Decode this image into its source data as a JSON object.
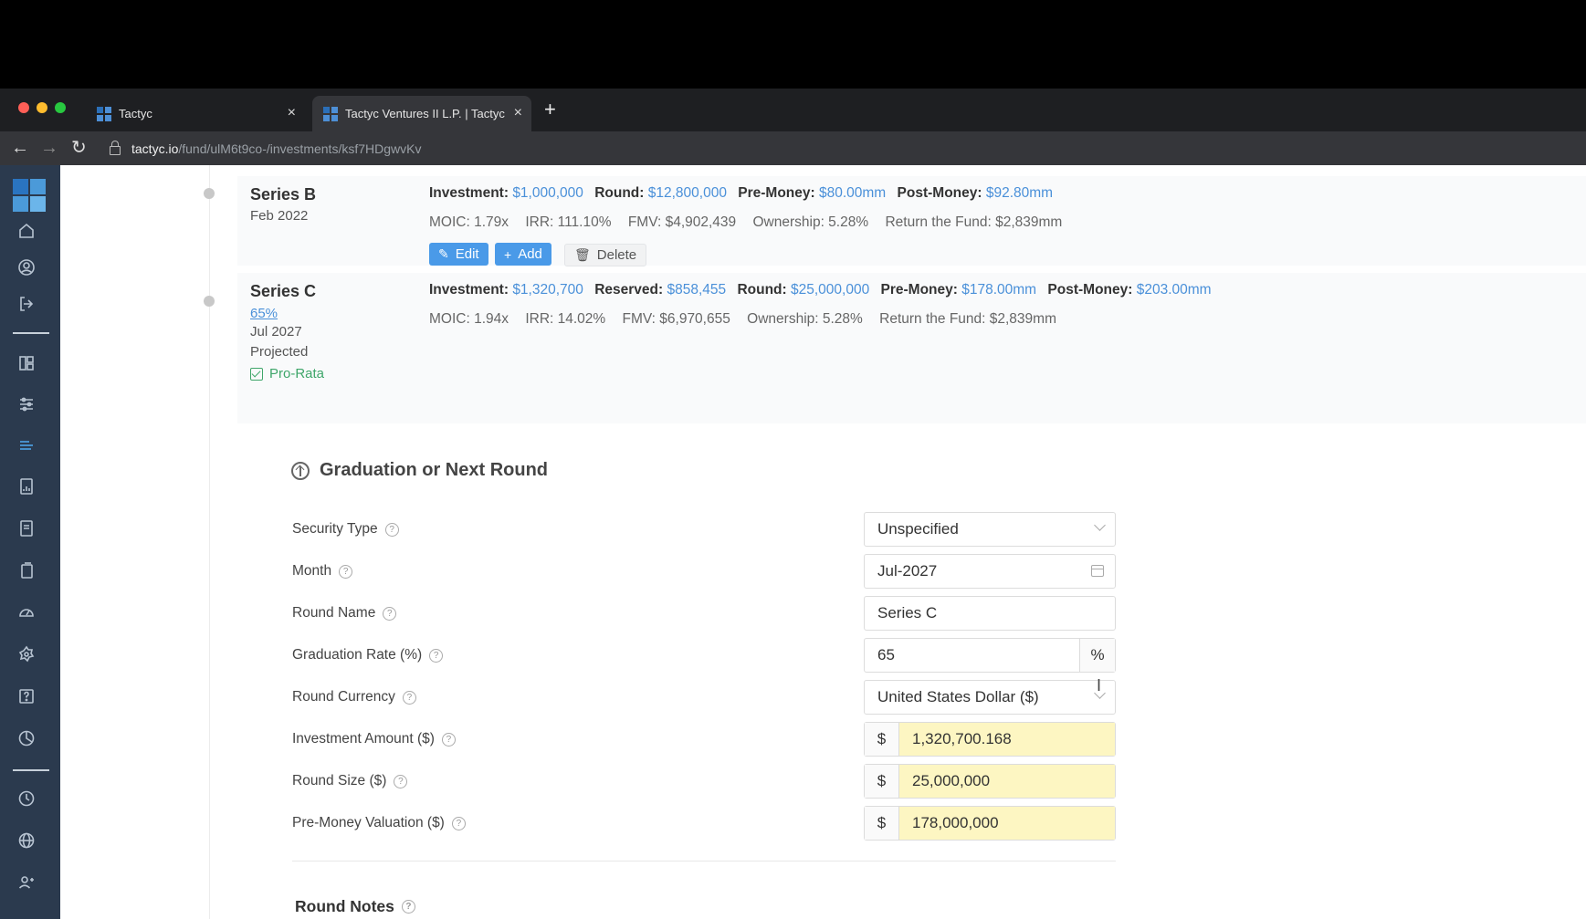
{
  "browser": {
    "tabs": [
      {
        "title": "Tactyc"
      },
      {
        "title": "Tactyc Ventures II L.P. | Tactyc"
      }
    ],
    "url_host": "tactyc.io",
    "url_path": "/fund/ulM6t9co-/investments/ksf7HDgwvKv",
    "new_tab_label": "+",
    "close_label": "×"
  },
  "sidebar": {
    "icons": [
      "home-icon",
      "user-icon",
      "logout-icon",
      "dashboard-icon",
      "sliders-icon",
      "list-icon",
      "report-icon",
      "document-icon",
      "copy-icon",
      "gauge-icon",
      "settings-icon",
      "help-icon",
      "pie-chart-icon",
      "clock-icon",
      "globe-icon",
      "add-user-icon"
    ]
  },
  "rounds": [
    {
      "name": "Series B",
      "date": "Feb 2022",
      "metrics_top": [
        {
          "label": "Investment:",
          "value": "$1,000,000"
        },
        {
          "label": "Round:",
          "value": "$12,800,000"
        },
        {
          "label": "Pre-Money:",
          "value": "$80.00mm"
        },
        {
          "label": "Post-Money:",
          "value": "$92.80mm"
        }
      ],
      "metrics_bottom": [
        "MOIC: 1.79x",
        "IRR: 111.10%",
        "FMV: $4,902,439",
        "Ownership: 5.28%",
        "Return the Fund: $2,839mm"
      ],
      "buttons": {
        "edit": "Edit",
        "add": "Add",
        "delete": "Delete"
      }
    },
    {
      "name": "Series C",
      "grad_rate": "65%",
      "date": "Jul 2027",
      "status": "Projected",
      "pro_rata": "Pro-Rata",
      "metrics_top": [
        {
          "label": "Investment:",
          "value": "$1,320,700"
        },
        {
          "label": "Reserved:",
          "value": "$858,455"
        },
        {
          "label": "Round:",
          "value": "$25,000,000"
        },
        {
          "label": "Pre-Money:",
          "value": "$178.00mm"
        },
        {
          "label": "Post-Money:",
          "value": "$203.00mm"
        }
      ],
      "metrics_bottom": [
        "MOIC: 1.94x",
        "IRR: 14.02%",
        "FMV: $6,970,655",
        "Ownership: 5.28%",
        "Return the Fund: $2,839mm"
      ]
    }
  ],
  "graduation": {
    "title": "Graduation or Next Round",
    "fields": {
      "security_type": {
        "label": "Security Type",
        "value": "Unspecified"
      },
      "month": {
        "label": "Month",
        "value": "Jul-2027"
      },
      "round_name": {
        "label": "Round Name",
        "value": "Series C"
      },
      "grad_rate": {
        "label": "Graduation Rate (%)",
        "value": "65",
        "suffix": "%"
      },
      "round_currency": {
        "label": "Round Currency",
        "value": "United States Dollar ($)"
      },
      "investment_amount": {
        "label": "Investment Amount ($)",
        "prefix": "$",
        "value": "1,320,700.168"
      },
      "round_size": {
        "label": "Round Size ($)",
        "prefix": "$",
        "value": "25,000,000"
      },
      "pre_money": {
        "label": "Pre-Money Valuation ($)",
        "prefix": "$",
        "value": "178,000,000"
      }
    },
    "notes_title": "Round Notes",
    "help_glyph": "?"
  }
}
